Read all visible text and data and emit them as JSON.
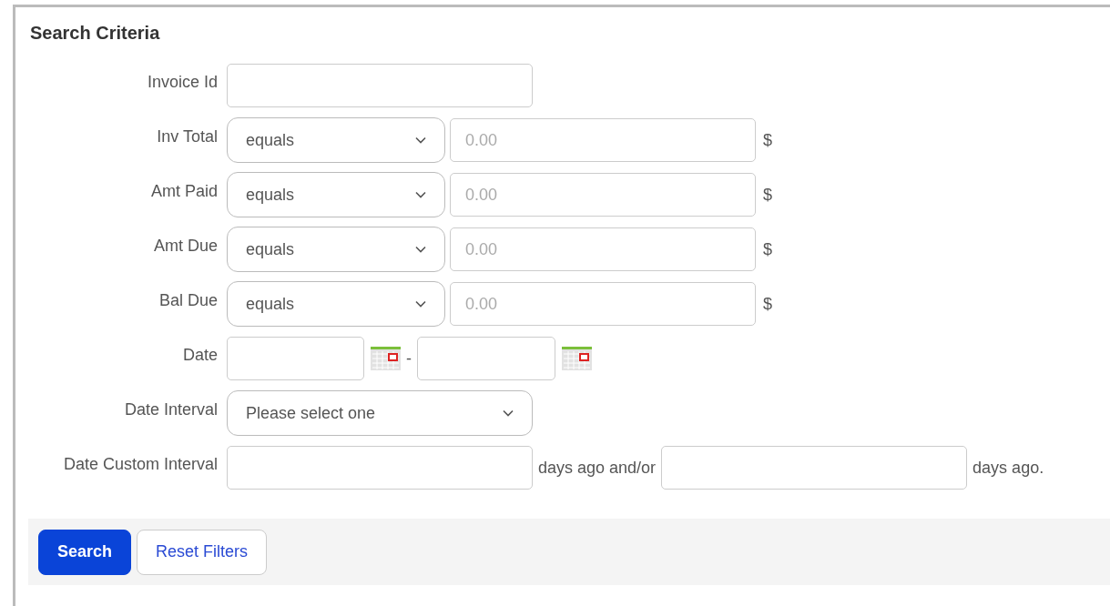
{
  "panel": {
    "title": "Search Criteria"
  },
  "rows": [
    {
      "kind": "text",
      "label": "Invoice Id"
    },
    {
      "kind": "compare",
      "label": "Inv Total",
      "operator": "equals",
      "placeholder": "0.00",
      "unit": "$"
    },
    {
      "kind": "compare",
      "label": "Amt Paid",
      "operator": "equals",
      "placeholder": "0.00",
      "unit": "$"
    },
    {
      "kind": "compare",
      "label": "Amt Due",
      "operator": "equals",
      "placeholder": "0.00",
      "unit": "$"
    },
    {
      "kind": "compare",
      "label": "Bal Due",
      "operator": "equals",
      "placeholder": "0.00",
      "unit": "$"
    },
    {
      "kind": "date",
      "label": "Date",
      "separator": "-"
    },
    {
      "kind": "select",
      "label": "Date Interval",
      "value": "Please select one"
    },
    {
      "kind": "custom",
      "label": "Date Custom Interval",
      "middle_text": "days ago and/or",
      "end_text": "days ago."
    }
  ],
  "buttons": [
    {
      "label": "Search",
      "kind": "primary"
    },
    {
      "label": "Reset Filters",
      "kind": "secondary"
    }
  ]
}
